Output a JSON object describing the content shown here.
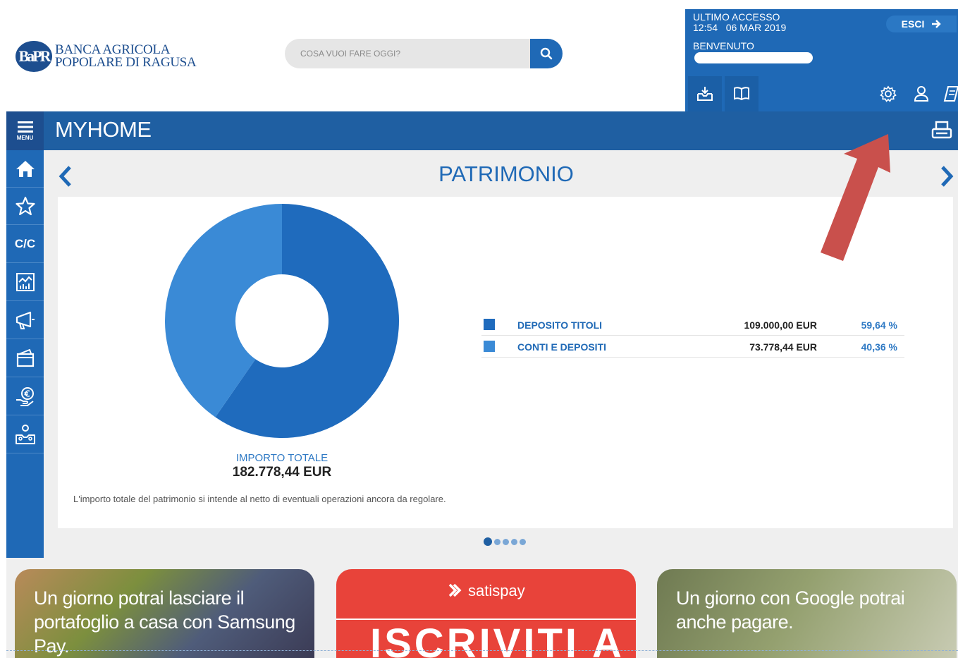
{
  "header": {
    "logo_mark": "BaPR",
    "logo_line1": "BANCA AGRICOLA",
    "logo_line2": "POPOLARE DI RAGUSA",
    "search_placeholder": "COSA VUOI FARE OGGI?"
  },
  "user_panel": {
    "last_access_label": "ULTIMO ACCESSO",
    "last_access_time": "12:54",
    "last_access_date": "06 MAR 2019",
    "logout_label": "ESCI",
    "welcome_label": "BENVENUTO"
  },
  "topbar": {
    "menu_label": "MENU",
    "title": "MYHOME"
  },
  "sidebar": {
    "items": [
      {
        "icon": "home-icon"
      },
      {
        "icon": "star-icon"
      },
      {
        "label": "C/C"
      },
      {
        "icon": "chart-icon"
      },
      {
        "icon": "megaphone-icon"
      },
      {
        "icon": "card-icon"
      },
      {
        "icon": "euro-hand-icon"
      },
      {
        "icon": "family-icon"
      }
    ]
  },
  "main": {
    "section_title": "PATRIMONIO",
    "total_label": "IMPORTO TOTALE",
    "total_value": "182.778,44 EUR",
    "footnote": "L'importo totale del patrimonio si intende al netto di eventuali operazioni ancora da regolare.",
    "legend": [
      {
        "name": "DEPOSITO TITOLI",
        "amount": "109.000,00 EUR",
        "percent": "59,64 %",
        "color": "#1f6bbd"
      },
      {
        "name": "CONTI E DEPOSITI",
        "amount": "73.778,44 EUR",
        "percent": "40,36 %",
        "color": "#3a8ad6"
      }
    ],
    "carousel_dots": 5,
    "active_dot": 0
  },
  "chart_data": {
    "type": "pie",
    "categories": [
      "DEPOSITO TITOLI",
      "CONTI E DEPOSITI"
    ],
    "values": [
      59.64,
      40.36
    ],
    "colors": [
      "#1f6bbd",
      "#3a8ad6"
    ],
    "donut": true
  },
  "banners": [
    {
      "text": "Un giorno potrai lasciare il portafoglio a casa con Samsung Pay."
    },
    {
      "brand": "satispay",
      "headline": "ISCRIVITI A"
    },
    {
      "text": "Un giorno con Google potrai anche pagare."
    }
  ],
  "colors": {
    "primary": "#1f69b6",
    "dark": "#1f5fa2",
    "annotation_arrow": "#c9504c"
  }
}
